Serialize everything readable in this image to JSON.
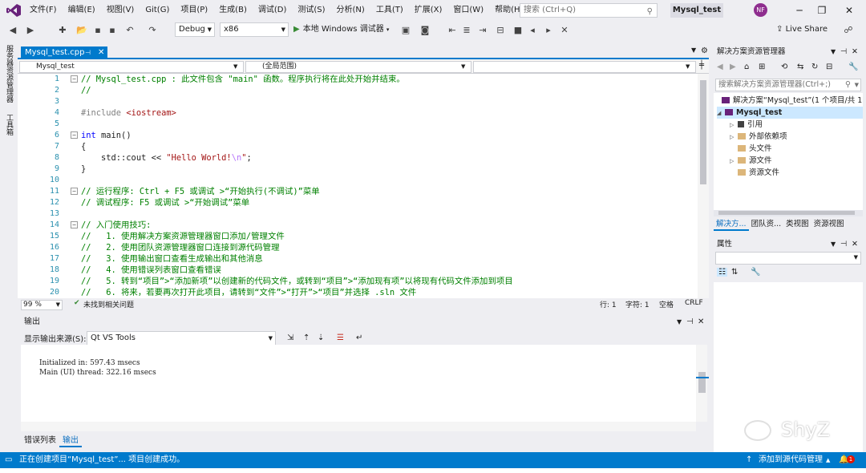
{
  "menu": {
    "items": [
      "文件(F)",
      "编辑(E)",
      "视图(V)",
      "Git(G)",
      "项目(P)",
      "生成(B)",
      "调试(D)",
      "测试(S)",
      "分析(N)",
      "工具(T)",
      "扩展(X)",
      "窗口(W)",
      "帮助(H)"
    ],
    "search_placeholder": "搜索 (Ctrl+Q)",
    "solution_name": "Mysql_test",
    "avatar_initials": "NF"
  },
  "toolbar": {
    "config": "Debug",
    "platform": "x86",
    "run_label": "本地 Windows 调试器",
    "live_share": "Live Share"
  },
  "left_strip": {
    "items": [
      "服务器资源管理器",
      "工具箱"
    ]
  },
  "editor": {
    "tab_name": "Mysql_test.cpp",
    "nav_project": "Mysql_test",
    "nav_scope": "(全局范围)",
    "nav_member": "",
    "lines": [
      {
        "n": "1",
        "fold": "⊟",
        "parts": [
          {
            "t": "// Mysql_test.cpp : 此文件包含 \"main\" 函数。程序执行将在此处开始并结束。",
            "c": "c-com"
          }
        ]
      },
      {
        "n": "2",
        "fold": "",
        "parts": [
          {
            "t": "//",
            "c": "c-com"
          }
        ]
      },
      {
        "n": "3",
        "fold": "",
        "parts": []
      },
      {
        "n": "4",
        "fold": "",
        "parts": [
          {
            "t": "#include ",
            "c": "c-pp"
          },
          {
            "t": "<iostream>",
            "c": "c-str"
          }
        ]
      },
      {
        "n": "5",
        "fold": "",
        "parts": []
      },
      {
        "n": "6",
        "fold": "⊟",
        "parts": [
          {
            "t": "int",
            "c": "c-kw"
          },
          {
            "t": " main()",
            "c": "c-id"
          }
        ]
      },
      {
        "n": "7",
        "fold": "",
        "parts": [
          {
            "t": "{",
            "c": "c-id"
          }
        ]
      },
      {
        "n": "8",
        "fold": "",
        "parts": [
          {
            "t": "    std::cout << ",
            "c": "c-id"
          },
          {
            "t": "\"Hello World!",
            "c": "c-str"
          },
          {
            "t": "\\n",
            "c": "c-esc"
          },
          {
            "t": "\"",
            "c": "c-str"
          },
          {
            "t": ";",
            "c": "c-id"
          }
        ]
      },
      {
        "n": "9",
        "fold": "",
        "parts": [
          {
            "t": "}",
            "c": "c-id"
          }
        ]
      },
      {
        "n": "10",
        "fold": "",
        "parts": []
      },
      {
        "n": "11",
        "fold": "⊟",
        "parts": [
          {
            "t": "// 运行程序: Ctrl + F5 或调试 >“开始执行(不调试)”菜单",
            "c": "c-com"
          }
        ]
      },
      {
        "n": "12",
        "fold": "",
        "parts": [
          {
            "t": "// 调试程序: F5 或调试 >“开始调试”菜单",
            "c": "c-com"
          }
        ]
      },
      {
        "n": "13",
        "fold": "",
        "parts": []
      },
      {
        "n": "14",
        "fold": "⊟",
        "parts": [
          {
            "t": "// 入门使用技巧: ",
            "c": "c-com"
          }
        ]
      },
      {
        "n": "15",
        "fold": "",
        "parts": [
          {
            "t": "//   1. 使用解决方案资源管理器窗口添加/管理文件",
            "c": "c-com"
          }
        ]
      },
      {
        "n": "16",
        "fold": "",
        "parts": [
          {
            "t": "//   2. 使用团队资源管理器窗口连接到源代码管理",
            "c": "c-com"
          }
        ]
      },
      {
        "n": "17",
        "fold": "",
        "parts": [
          {
            "t": "//   3. 使用输出窗口查看生成输出和其他消息",
            "c": "c-com"
          }
        ]
      },
      {
        "n": "18",
        "fold": "",
        "parts": [
          {
            "t": "//   4. 使用错误列表窗口查看错误",
            "c": "c-com"
          }
        ]
      },
      {
        "n": "19",
        "fold": "",
        "parts": [
          {
            "t": "//   5. 转到“项目”>“添加新项”以创建新的代码文件，或转到“项目”>“添加现有项”以将现有代码文件添加到项目",
            "c": "c-com"
          }
        ]
      },
      {
        "n": "20",
        "fold": "",
        "parts": [
          {
            "t": "//   6. 将来，若要再次打开此项目，请转到“文件”>“打开”>“项目”并选择 .sln 文件",
            "c": "c-com"
          }
        ]
      }
    ],
    "zoom": "99 %",
    "issues": "未找到相关问题",
    "line_pos": "行: 1",
    "char_pos": "字符: 1",
    "ws_mode": "空格",
    "eol": "CRLF"
  },
  "output": {
    "title": "输出",
    "source_label": "显示输出来源(S):",
    "source_value": "Qt VS Tools",
    "lines": [
      "Initialized in: 597.43 msecs",
      "Main (UI) thread: 322.16 msecs"
    ],
    "tabs": [
      "错误列表",
      "输出"
    ]
  },
  "solution_explorer": {
    "title": "解决方案资源管理器",
    "search_placeholder": "搜索解决方案资源管理器(Ctrl+;)",
    "solution_row": "解决方案“Mysql_test”(1 个项目/共 1",
    "project": "Mysql_test",
    "nodes": [
      "引用",
      "外部依赖项",
      "头文件",
      "源文件",
      "资源文件"
    ],
    "tabs": [
      "解决方...",
      "团队资...",
      "类视图",
      "资源视图"
    ]
  },
  "properties": {
    "title": "属性"
  },
  "watermark": "ShyZ",
  "status": {
    "message": "正在创建项目“Mysql_test”... 项目创建成功。",
    "source_control": "添加到源代码管理",
    "notifications": "1"
  }
}
